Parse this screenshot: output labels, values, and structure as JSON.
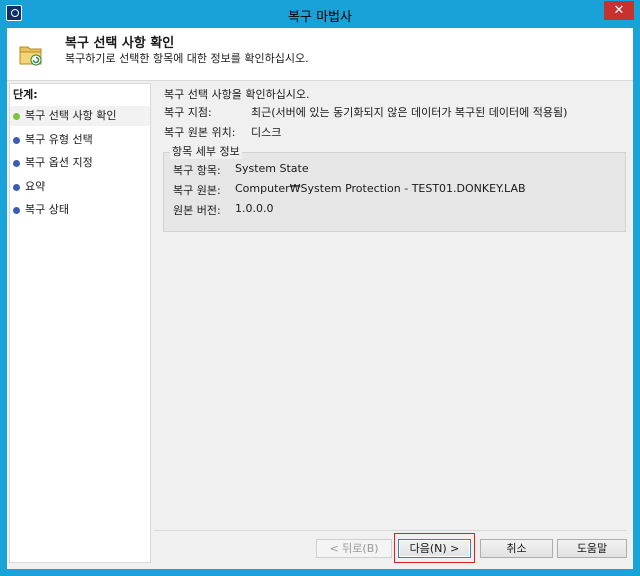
{
  "window": {
    "title": "복구 마법사",
    "close_label": "✕"
  },
  "header": {
    "title": "복구 선택 사항 확인",
    "description": "복구하기로 선택한 항목에 대한 정보를 확인하십시오."
  },
  "steps": {
    "heading": "단계:",
    "items": [
      {
        "label": "복구 선택 사항 확인",
        "active": true
      },
      {
        "label": "복구 유형 선택",
        "active": false
      },
      {
        "label": "복구 옵션 지정",
        "active": false
      },
      {
        "label": "요약",
        "active": false
      },
      {
        "label": "복구 상태",
        "active": false
      }
    ]
  },
  "content": {
    "intro": "복구 선택 사항을 확인하십시오.",
    "destination_label": "복구 지점:",
    "destination_value": "최근(서버에 있는 동기화되지 않은 데이터가 복구된 데이터에 적용됨)",
    "source_label": "복구 원본 위치:",
    "source_value": "디스크",
    "group_title": "항목 세부 정보",
    "item_label": "복구 항목:",
    "item_value": "System State",
    "origin_label": "복구 원본:",
    "origin_value": "Computer₩System Protection - TEST01.DONKEY.LAB",
    "version_label": "원본 버전:",
    "version_value": "1.0.0.0"
  },
  "buttons": {
    "back": "< 뒤로(B)",
    "next": "다음(N) >",
    "cancel": "취소",
    "help": "도움말"
  }
}
